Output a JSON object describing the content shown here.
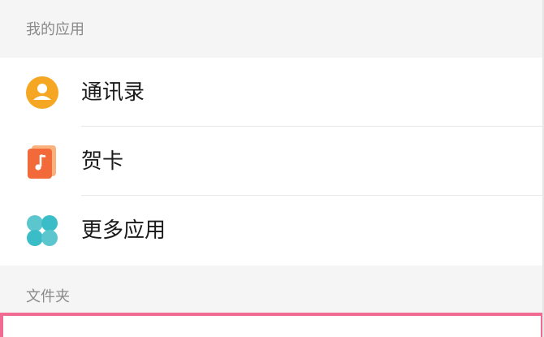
{
  "sections": {
    "my_apps": "我的应用",
    "folders": "文件夹"
  },
  "apps": [
    {
      "label": "通讯录",
      "icon": "contacts-icon",
      "color": "#f5a623"
    },
    {
      "label": "贺卡",
      "icon": "greeting-card-icon",
      "color": "#f26a3a"
    },
    {
      "label": "更多应用",
      "icon": "more-apps-icon",
      "color": "#3bbdc8"
    }
  ],
  "colors": {
    "section_background": "#f5f5f5",
    "highlight_border": "#f06a91"
  }
}
